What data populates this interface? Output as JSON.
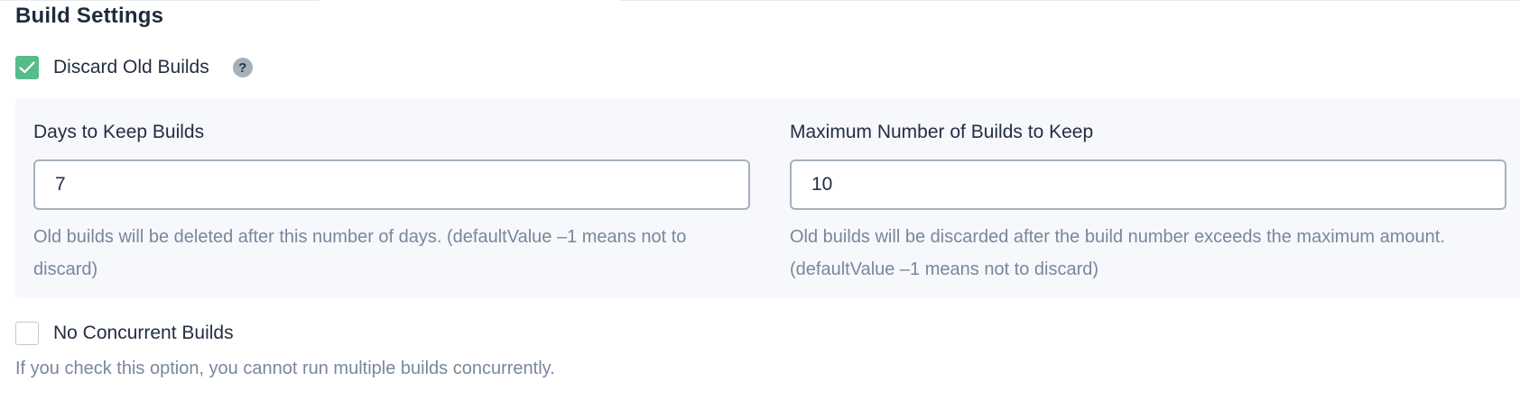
{
  "section": {
    "title": "Build Settings"
  },
  "discard_old_builds": {
    "label": "Discard Old Builds",
    "checked": true,
    "help_icon_glyph": "?",
    "days_to_keep": {
      "label": "Days to Keep Builds",
      "value": "7",
      "description": "Old builds will be deleted after this number of days. (defaultValue –1 means not to discard)"
    },
    "max_builds_to_keep": {
      "label": "Maximum Number of Builds to Keep",
      "value": "10",
      "description": "Old builds will be discarded after the build number exceeds the maximum amount. (defaultValue –1 means not to discard)"
    }
  },
  "no_concurrent_builds": {
    "label": "No Concurrent Builds",
    "checked": false,
    "description": "If you check this option, you cannot run multiple builds concurrently."
  },
  "colors": {
    "accent_green": "#55bc8a",
    "panel_bg": "#f6f8fc",
    "text_primary": "#242e42",
    "text_secondary": "#79879c"
  },
  "icons": {
    "checkmark": "check-icon",
    "help": "help-icon"
  }
}
